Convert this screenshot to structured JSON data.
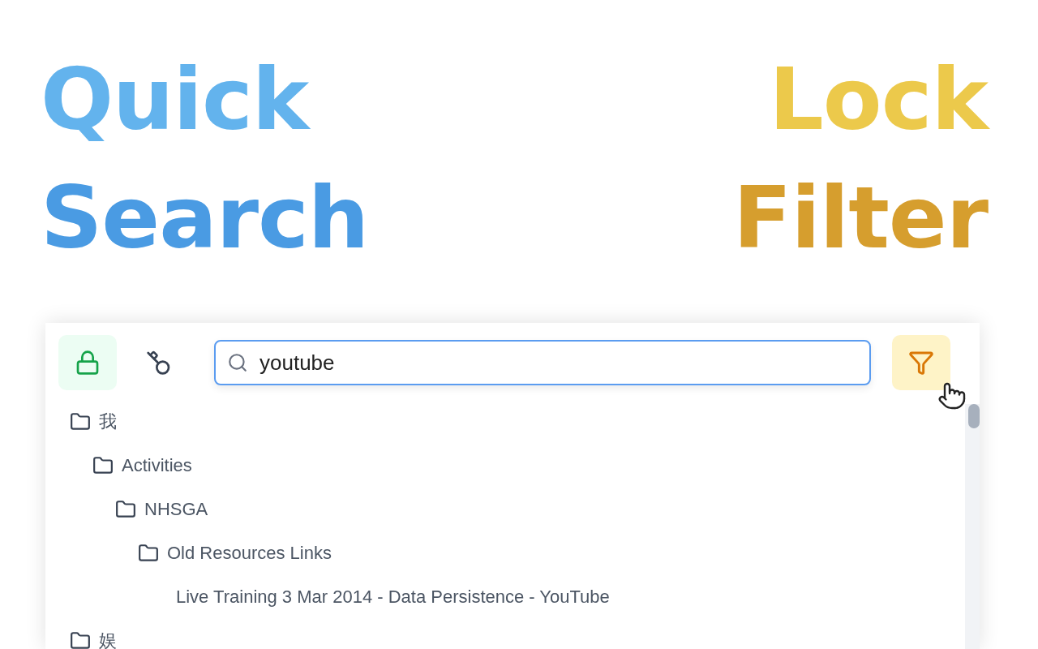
{
  "headline": {
    "left": [
      "Quick",
      "Search"
    ],
    "right": [
      "Lock",
      "Filter"
    ]
  },
  "toolbar": {
    "buttons": [
      {
        "kind": "lock",
        "on": true
      },
      {
        "kind": "key",
        "on": false
      }
    ],
    "search": {
      "value": "youtube"
    },
    "filter": {
      "on": true
    }
  },
  "tree": [
    {
      "kind": "folder",
      "label": "我",
      "children": [
        {
          "kind": "folder",
          "label": "Activities",
          "children": [
            {
              "kind": "folder",
              "label": "NHSGA",
              "children": [
                {
                  "kind": "folder",
                  "label": "Old Resources Links",
                  "children": [
                    {
                      "kind": "bookmark",
                      "label": "Live Training 3 Mar 2014 - Data Persistence - YouTube"
                    }
                  ]
                }
              ]
            }
          ]
        }
      ]
    },
    {
      "kind": "folder",
      "label": "娱"
    }
  ]
}
